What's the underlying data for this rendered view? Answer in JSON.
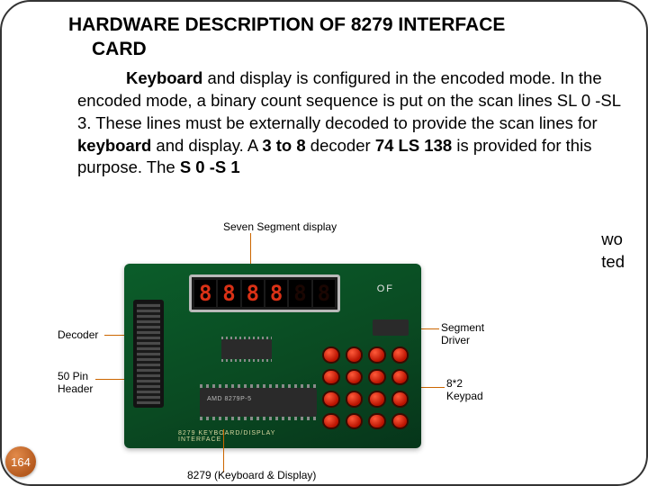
{
  "title_line1": "HARDWARE DESCRIPTION OF 8279 INTERFACE",
  "title_line2": "CARD",
  "para": {
    "w_keyboard1": "Keyboard",
    "t1": " and display is configured in the ",
    "t2": "encoded mode. In the encoded mode, a binary count sequence is put on the scan lines SL 0 -SL 3. These lines must be externally decoded to provide the scan lines for ",
    "w_keyboard2": "keyboard",
    "t3": " and display. A ",
    "w_3to8": "3 to 8",
    "t4": " decoder ",
    "w_74ls138": "74 LS 138",
    "t5": " is provided for this purpose. The ",
    "w_s0s1": "S 0 -S 1"
  },
  "frag_right_l1": "wo",
  "frag_right_l2": "ted",
  "annot": {
    "seven_seg": "Seven Segment display",
    "segment_driver_l1": "Segment",
    "segment_driver_l2": "Driver",
    "decoder": "Decoder",
    "header_l1": "50 Pin",
    "header_l2": "Header",
    "keypad_l1": "8*2",
    "keypad_l2": "Keypad",
    "caption": "8279 (Keyboard & Display)"
  },
  "board": {
    "of": "OF",
    "chip": "AMD 8279P-5",
    "strip": "8279 KEYBOARD/DISPLAY INTERFACE"
  },
  "page_number": "164"
}
